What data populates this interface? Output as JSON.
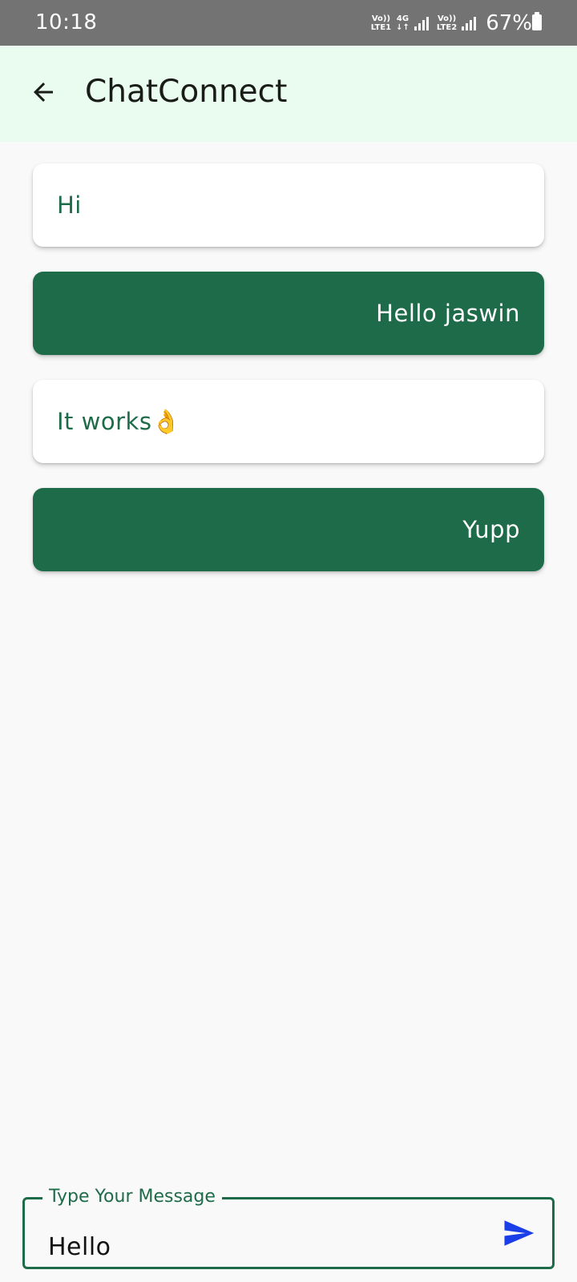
{
  "status_bar": {
    "time": "10:18",
    "sim1": {
      "top": "Vo))",
      "bottom": "LTE1"
    },
    "network_type": {
      "top": "4G",
      "bottom": "↓↑"
    },
    "sim2": {
      "top": "Vo))",
      "bottom": "LTE2"
    },
    "battery_percent": "67%"
  },
  "app_bar": {
    "title": "ChatConnect",
    "back_icon": "arrow-back-icon"
  },
  "messages": [
    {
      "text": "Hi",
      "direction": "received"
    },
    {
      "text": "Hello jaswin",
      "direction": "sent"
    },
    {
      "text": "It works👌",
      "direction": "received"
    },
    {
      "text": "Yupp",
      "direction": "sent"
    }
  ],
  "composer": {
    "label": "Type Your Message",
    "value": "Hello",
    "send_icon": "send-icon"
  },
  "colors": {
    "accent": "#1e6b4a",
    "app_bar_bg": "#e9fcef",
    "status_bar_bg": "#737373",
    "send_icon": "#1a3ee8"
  }
}
